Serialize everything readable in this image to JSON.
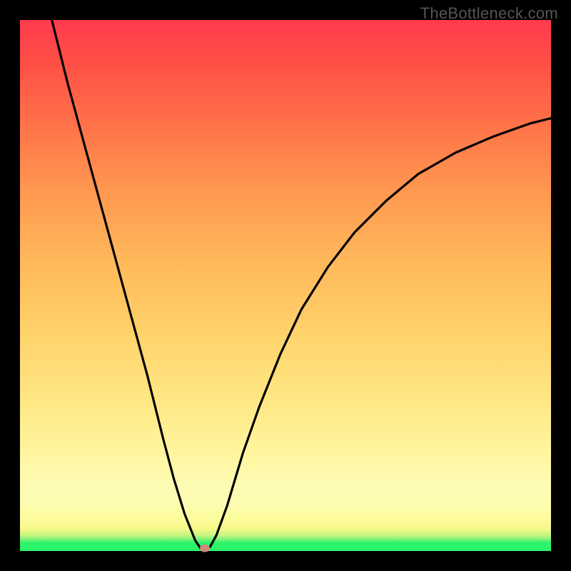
{
  "watermark": "TheBottleneck.com",
  "chart_data": {
    "type": "line",
    "title": "",
    "xlabel": "",
    "ylabel": "",
    "xlim": [
      0,
      1
    ],
    "ylim": [
      0,
      1
    ],
    "x": [
      0.06,
      0.09,
      0.12,
      0.15,
      0.18,
      0.21,
      0.24,
      0.27,
      0.29,
      0.31,
      0.33,
      0.34,
      0.347,
      0.358,
      0.37,
      0.39,
      0.42,
      0.45,
      0.49,
      0.53,
      0.58,
      0.63,
      0.69,
      0.75,
      0.82,
      0.89,
      0.96,
      1.0
    ],
    "y": [
      1.0,
      0.88,
      0.77,
      0.66,
      0.55,
      0.44,
      0.33,
      0.21,
      0.135,
      0.07,
      0.02,
      0.005,
      0.0,
      0.008,
      0.03,
      0.085,
      0.185,
      0.27,
      0.37,
      0.455,
      0.535,
      0.6,
      0.66,
      0.71,
      0.75,
      0.78,
      0.805,
      0.815
    ],
    "marker": {
      "x": 0.348,
      "y": 0.0
    },
    "background_gradient": {
      "direction": "vertical",
      "stops": [
        {
          "pos": 0.0,
          "color": "#2bf36a"
        },
        {
          "pos": 0.015,
          "color": "#2bf36a"
        },
        {
          "pos": 0.042,
          "color": "#f6f98a"
        },
        {
          "pos": 0.12,
          "color": "#fefcb5"
        },
        {
          "pos": 0.4,
          "color": "#ffd46c"
        },
        {
          "pos": 0.68,
          "color": "#ff9750"
        },
        {
          "pos": 1.0,
          "color": "#ff3a4f"
        }
      ]
    }
  },
  "colors": {
    "curve": "#000000",
    "frame": "#000000",
    "marker": "#cf8a78",
    "watermark": "#555555"
  }
}
